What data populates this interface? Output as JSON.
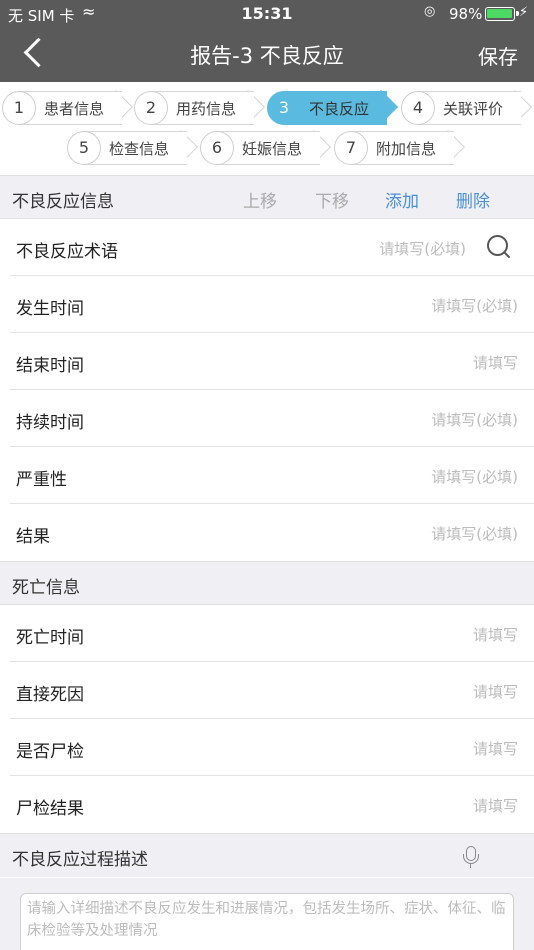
{
  "status": {
    "carrier": "无 SIM 卡",
    "time": "15:31",
    "battery_pct": "98%",
    "battery_level": 0.98
  },
  "nav": {
    "title": "报告-3 不良反应",
    "save_label": "保存"
  },
  "steps": [
    {
      "num": "1",
      "label": "患者信息",
      "active": false
    },
    {
      "num": "2",
      "label": "用药信息",
      "active": false
    },
    {
      "num": "3",
      "label": "不良反应",
      "active": true
    },
    {
      "num": "4",
      "label": "关联评价",
      "active": false
    },
    {
      "num": "5",
      "label": "检查信息",
      "active": false
    },
    {
      "num": "6",
      "label": "妊娠信息",
      "active": false
    },
    {
      "num": "7",
      "label": "附加信息",
      "active": false
    }
  ],
  "adverse_section": {
    "title": "不良反应信息",
    "move_up": "上移",
    "move_down": "下移",
    "add": "添加",
    "delete": "删除",
    "rows": [
      {
        "label": "不良反应术语",
        "placeholder": "请填写(必填)"
      },
      {
        "label": "发生时间",
        "placeholder": "请填写(必填)"
      },
      {
        "label": "结束时间",
        "placeholder": "请填写"
      },
      {
        "label": "持续时间",
        "placeholder": "请填写(必填)"
      },
      {
        "label": "严重性",
        "placeholder": "请填写(必填)"
      },
      {
        "label": "结果",
        "placeholder": "请填写(必填)"
      }
    ]
  },
  "death_section": {
    "title": "死亡信息",
    "rows": [
      {
        "label": "死亡时间",
        "placeholder": "请填写"
      },
      {
        "label": "直接死因",
        "placeholder": "请填写"
      },
      {
        "label": "是否尸检",
        "placeholder": "请填写"
      },
      {
        "label": "尸检结果",
        "placeholder": "请填写"
      }
    ]
  },
  "process_section": {
    "title": "不良反应过程描述",
    "textarea_placeholder": "请输入详细描述不良反应发生和进展情况，包括发生场所、症状、体征、临床检验等及处理情况"
  },
  "colors": {
    "nav_bg": "#5a5a5a",
    "active_step": "#5bbadf",
    "link_blue": "#4a90d9"
  }
}
